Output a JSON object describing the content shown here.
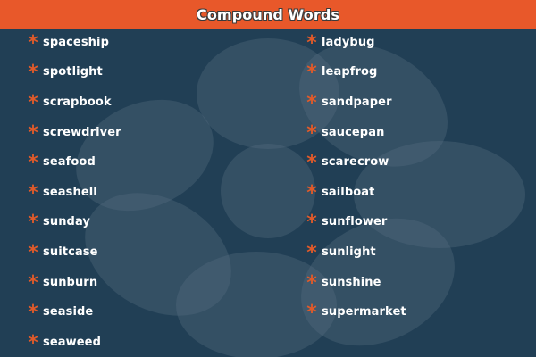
{
  "header": {
    "title": "Compound Words"
  },
  "words": {
    "left": [
      "spaceship",
      "spotlight",
      "scrapbook",
      "screwdriver",
      "seafood",
      "seashell",
      "sunday",
      "suitcase",
      "sunburn",
      "seaside",
      "seaweed"
    ],
    "right": [
      "ladybug",
      "leapfrog",
      "sandpaper",
      "saucepan",
      "scarecrow",
      "sailboat",
      "sunflower",
      "sunlight",
      "sunshine",
      "supermarket"
    ]
  },
  "icons": {
    "bullet": "asterisk-icon",
    "background": "flower-shape"
  },
  "colors": {
    "background": "#213f55",
    "header": "#e8582a",
    "bullet": "#e05a2a",
    "text": "#ffffff"
  }
}
